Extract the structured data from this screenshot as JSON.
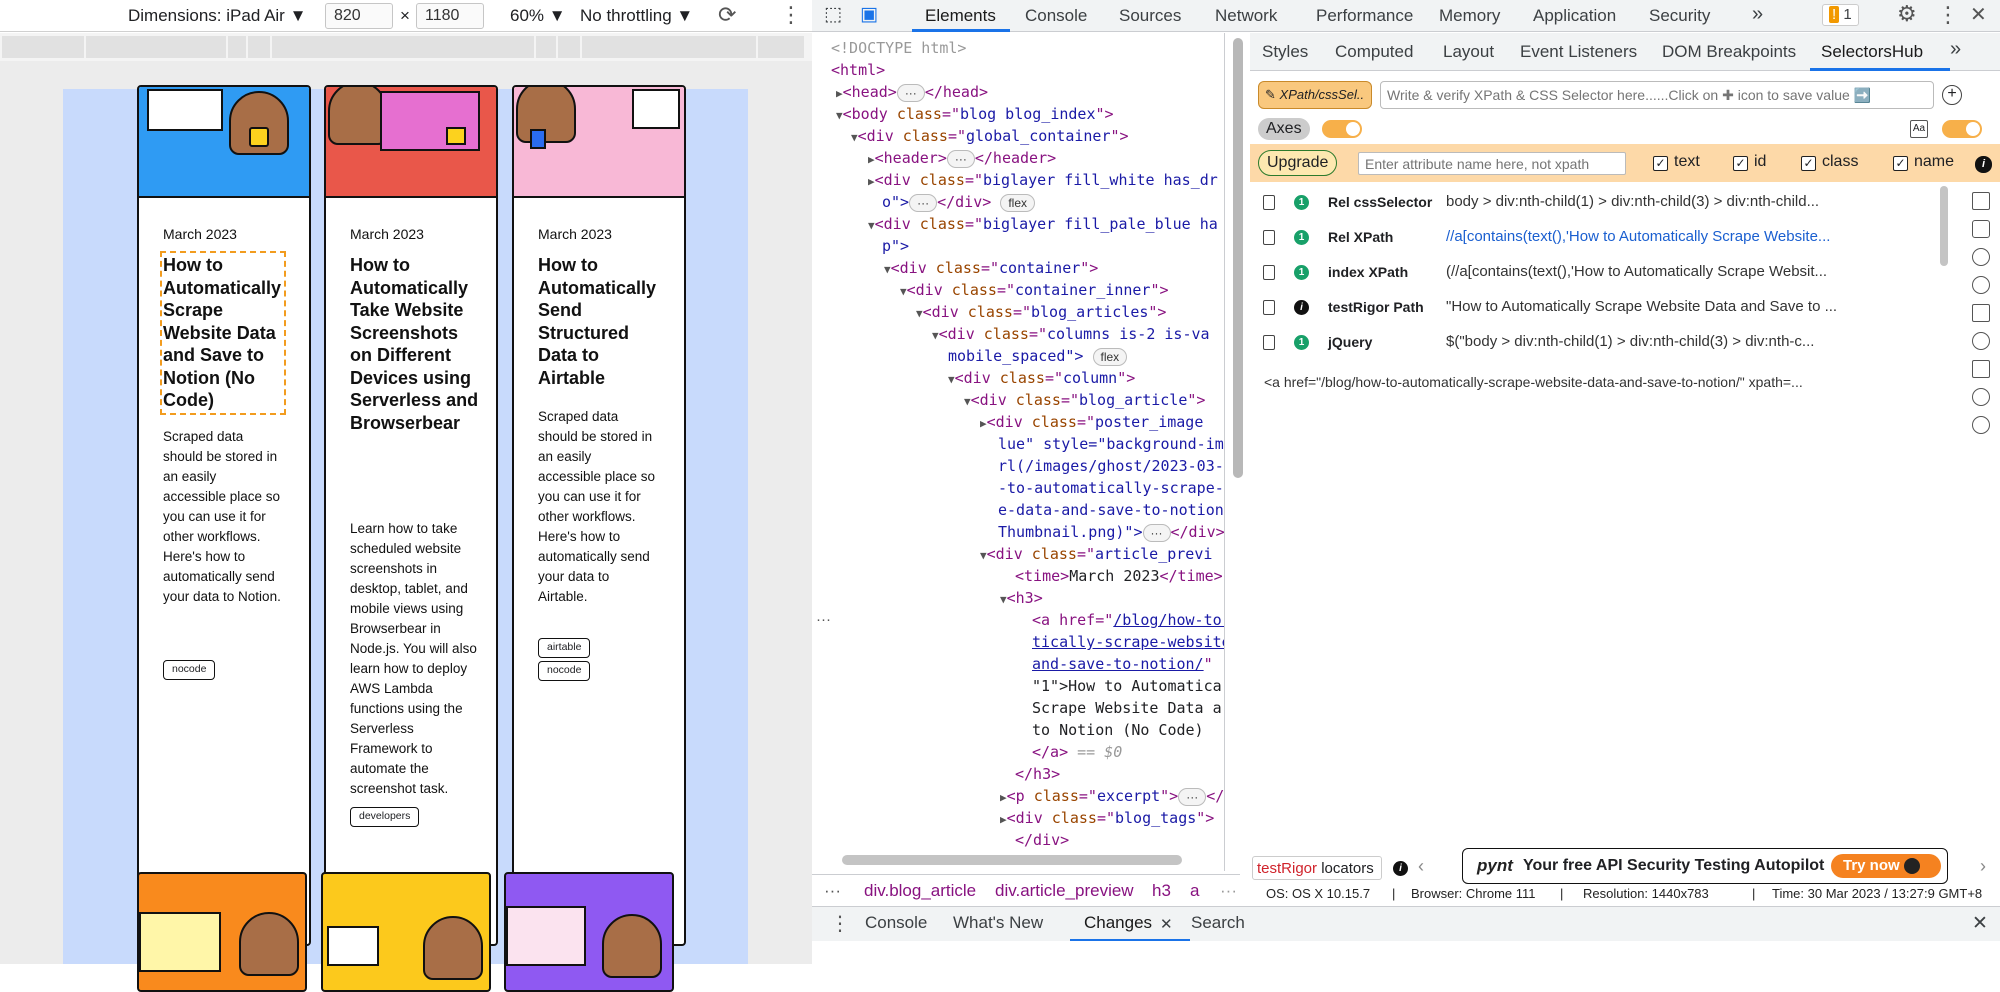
{
  "device_toolbar": {
    "dimensions_label": "Dimensions: iPad Air",
    "width": "820",
    "times": "×",
    "height": "1180",
    "zoom": "60%",
    "throttle": "No throttling"
  },
  "cards": [
    {
      "date": "March 2023",
      "title": "How to Automatically Scrape Website Data and Save to Notion (No Code)",
      "excerpt": "Scraped data should be stored in an easily accessible place so you can use it for other workflows. Here's how to automatically send your data to Notion.",
      "tags": [
        "nocode"
      ],
      "img_color": "#2f9bf3"
    },
    {
      "date": "March 2023",
      "title": "How to Automatically Take Website Screenshots on Different Devices using Serverless and Browserbear",
      "excerpt": "Learn how to take scheduled website screenshots in desktop, tablet, and mobile views using Browserbear in Node.js. You will also learn how to deploy AWS Lambda functions using the Serverless Framework to automate the screenshot task.",
      "tags": [
        "developers"
      ],
      "img_color": "#e9574a"
    },
    {
      "date": "March 2023",
      "title": "How to Automatically Send Structured Data to Airtable",
      "excerpt": "Scraped data should be stored in an easily accessible place so you can use it for other workflows. Here's how to automatically send your data to Airtable.",
      "tags": [
        "airtable",
        "nocode"
      ],
      "img_color": "#f8b8d6"
    }
  ],
  "bottom_cards": [
    {
      "img_color": "#f98a1d"
    },
    {
      "img_color": "#fcc91c"
    },
    {
      "img_color": "#8f59f2"
    }
  ],
  "devtools_tabs": [
    "Elements",
    "Console",
    "Sources",
    "Network",
    "Performance",
    "Memory",
    "Application",
    "Security"
  ],
  "more_tabs": "»",
  "issues_count": "1",
  "elements": {
    "doctype": "<!DOCTYPE html>",
    "html": "<html>",
    "head": "<head>",
    "head_close": "</head>",
    "body_open": "<body",
    "body_class": "blog blog_index",
    "global_container": "global_container",
    "header": "<header>",
    "header_close": "</header>",
    "biglayer1": "biglayer fill_white has_dr",
    "biglayer1_cont": "o\">",
    "div_close": "</div>",
    "flex": "flex",
    "biglayer2": "biglayer fill_pale_blue ha",
    "biglayer2_cont": "p\">",
    "container": "container",
    "container_inner": "container_inner",
    "blog_articles": "blog_articles",
    "columns": "columns is-2 is-va",
    "columns_cont": "mobile_spaced\">",
    "column": "column",
    "blog_article": "blog_article",
    "poster_image": "poster_image",
    "style_attr": "lue\" style=\"background-im",
    "style_l2": "rl(/images/ghost/2023-03-",
    "style_l3": "-to-automatically-scrape-",
    "style_l4": "e-data-and-save-to-notion",
    "style_l5": "Thumbnail.png)\">",
    "article_preview": "article_previ",
    "time_open": "<time>",
    "time_text": "March 2023",
    "time_close": "</time>",
    "h3_open": "<h3>",
    "a_open": "<a href=\"",
    "href_l1": "/blog/how-to-",
    "href_l2": "tically-scrape-website",
    "href_l3": "and-save-to-notion/",
    "a_tail": "\" :",
    "a_cont": "\"1\">How to Automatica",
    "a_text2": "Scrape Website Data ar",
    "a_text3": "to Notion (No Code)",
    "a_close": "</a>",
    "eq0": "== $0",
    "h3_close": "</h3>",
    "excerpt": "excerpt",
    "blog_tags": "blog_tags",
    "div_close2": "</div>"
  },
  "breadcrumbs": [
    "div.blog_article",
    "div.article_preview",
    "h3",
    "a"
  ],
  "drawer_tabs": [
    "Console",
    "What's New",
    "Changes",
    "Search"
  ],
  "side_tabs": [
    "Styles",
    "Computed",
    "Layout",
    "Event Listeners",
    "DOM Breakpoints",
    "SelectorsHub"
  ],
  "hub": {
    "mode_button": "XPath/cssSel..",
    "input_placeholder": "Write & verify XPath & CSS Selector here......Click on ✚ icon to save value ➡️",
    "axes": "Axes",
    "upgrade": "Upgrade",
    "attr_placeholder": "Enter attribute name here, not xpath",
    "checks": [
      "text",
      "id",
      "class",
      "name"
    ],
    "rows": [
      {
        "label": "Rel cssSelector",
        "value": "body > div:nth-child(1) > div:nth-child(3) > div:nth-child..."
      },
      {
        "label": "Rel XPath",
        "value": "//a[contains(text(),'How to Automatically Scrape Website..."
      },
      {
        "label": "index XPath",
        "value": "(//a[contains(text(),'How to Automatically Scrape Websit..."
      },
      {
        "label": "testRigor Path",
        "value": "\"How to Automatically Scrape Website Data and Save to ..."
      },
      {
        "label": "jQuery",
        "value": "$(\"body > div:nth-child(1) > div:nth-child(3) > div:nth-c..."
      }
    ],
    "outer_html": "<a href=\"/blog/how-to-automatically-scrape-website-data-and-save-to-notion/\" xpath=...",
    "testrigor": "testRigor",
    "locators": "locators",
    "ad_brand": "pynt",
    "ad_text": "Your free API Security Testing Autopilot",
    "ad_button": "Try now",
    "status": {
      "os": "OS: OS X 10.15.7",
      "browser": "Browser: Chrome 111",
      "resolution": "Resolution: 1440x783",
      "time": "Time: 30 Mar 2023 / 13:27:9 GMT+8"
    }
  }
}
